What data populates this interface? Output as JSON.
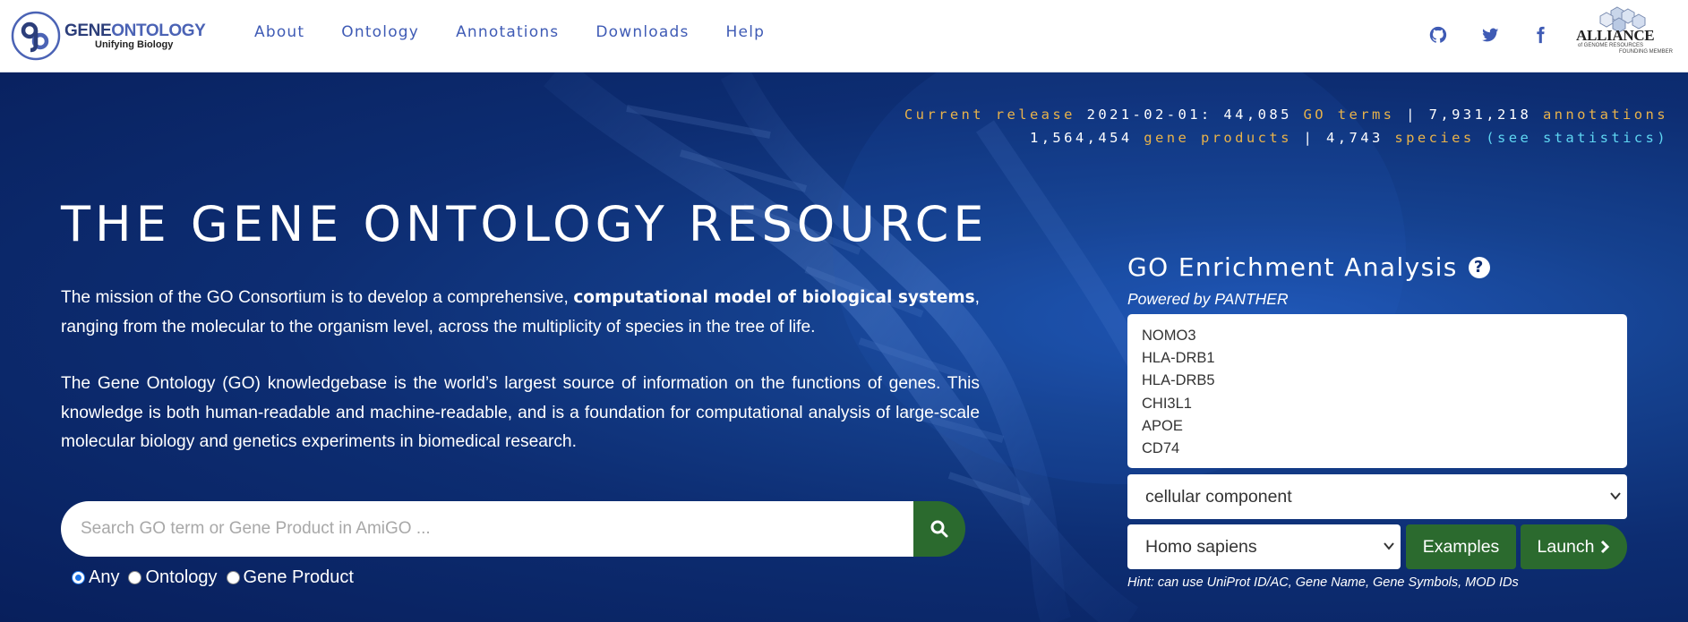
{
  "header": {
    "logo_brand_prefix": "GENE",
    "logo_brand_suffix": "ONTOLOGY",
    "logo_tagline": "Unifying Biology",
    "nav": [
      "About",
      "Ontology",
      "Annotations",
      "Downloads",
      "Help"
    ],
    "social_icons": [
      "github-icon",
      "twitter-icon",
      "facebook-icon"
    ],
    "alliance_name": "ALLIANCE",
    "alliance_sub_1": "of GENOME RESOURCES",
    "alliance_sub_2": "FOUNDING MEMBER"
  },
  "stats": {
    "release_label": "Current release",
    "release_date": "2021-02-01:",
    "go_terms_count": "44,085",
    "go_terms_label": "GO terms",
    "sep": "|",
    "annotations_count": "7,931,218",
    "annotations_label": "annotations",
    "gene_products_count": "1,564,454",
    "gene_products_label": "gene products",
    "species_count": "4,743",
    "species_label": "species",
    "see_statistics": "(see statistics)"
  },
  "hero": {
    "title": "THE GENE ONTOLOGY RESOURCE",
    "mission_pre": "The mission of the GO Consortium is to develop a comprehensive, ",
    "mission_bold": "computational model of biological systems",
    "mission_post": ", ranging from the molecular to the organism level, across the multiplicity of species in the tree of life.",
    "knowledge": "The Gene Ontology (GO) knowledgebase is the world’s largest source of information on the functions of genes. This knowledge is both human-readable and machine-readable, and is a foundation for computational analysis of large-scale molecular biology and genetics experiments in biomedical research."
  },
  "search": {
    "placeholder": "Search GO term or Gene Product in AmiGO ...",
    "value": "",
    "options": [
      "Any",
      "Ontology",
      "Gene Product"
    ],
    "selected": "Any"
  },
  "enrichment": {
    "title": "GO Enrichment Analysis",
    "help": "?",
    "powered_by": "Powered by PANTHER",
    "genes": [
      "NOMO3",
      "HLA-DRB1",
      "HLA-DRB5",
      "CHI3L1",
      "APOE",
      "CD74"
    ],
    "aspect_selected": "cellular component",
    "species_selected": "Homo sapiens",
    "examples_label": "Examples",
    "launch_label": "Launch",
    "hint": "Hint: can use UniProt ID/AC, Gene Name, Gene Symbols, MOD IDs"
  },
  "colors": {
    "brand_blue": "#3f5bb5",
    "hero_bg": "#0d2d72",
    "accent_orange": "#e8b24a",
    "accent_cyan": "#5fd6f2",
    "button_green": "#2b6a2e"
  }
}
